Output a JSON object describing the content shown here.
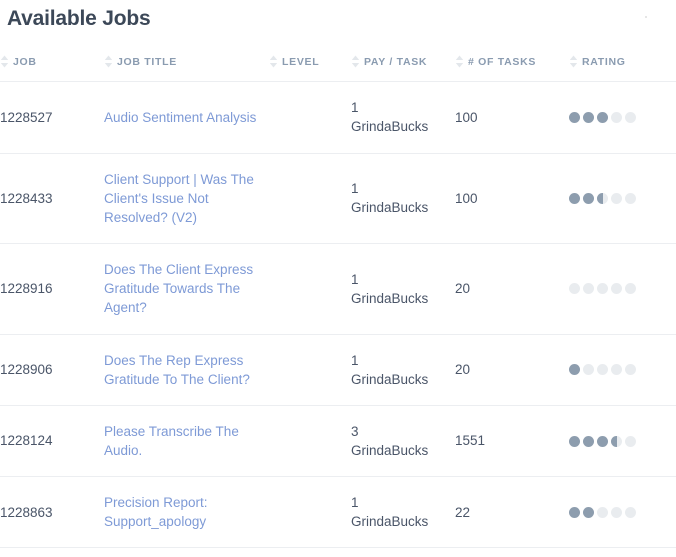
{
  "page": {
    "title": "Available Jobs"
  },
  "table": {
    "sort_icon": "sort-updown-icon",
    "columns": [
      {
        "key": "job",
        "label": "JOB"
      },
      {
        "key": "title",
        "label": "JOB TITLE"
      },
      {
        "key": "level",
        "label": "LEVEL"
      },
      {
        "key": "pay",
        "label": "PAY / TASK"
      },
      {
        "key": "tasks",
        "label": "# OF TASKS"
      },
      {
        "key": "rating",
        "label": "RATING"
      }
    ],
    "rows": [
      {
        "job": "1228527",
        "title": "Audio Sentiment Analysis",
        "level": "",
        "pay_amount": "1",
        "pay_currency": "GrindaBucks",
        "tasks": "100",
        "rating": 3,
        "rating_max": 5
      },
      {
        "job": "1228433",
        "title": "Client Support | Was The Client's Issue Not Resolved? (V2)",
        "level": "",
        "pay_amount": "1",
        "pay_currency": "GrindaBucks",
        "tasks": "100",
        "rating": 2.5,
        "rating_max": 5
      },
      {
        "job": "1228916",
        "title": "Does The Client Express Gratitude Towards The Agent?",
        "level": "",
        "pay_amount": "1",
        "pay_currency": "GrindaBucks",
        "tasks": "20",
        "rating": 0,
        "rating_max": 5
      },
      {
        "job": "1228906",
        "title": "Does The Rep Express Gratitude To The Client?",
        "level": "",
        "pay_amount": "1",
        "pay_currency": "GrindaBucks",
        "tasks": "20",
        "rating": 1,
        "rating_max": 5
      },
      {
        "job": "1228124",
        "title": "Please Transcribe The Audio.",
        "level": "",
        "pay_amount": "3",
        "pay_currency": "GrindaBucks",
        "tasks": "1551",
        "rating": 3.5,
        "rating_max": 5
      },
      {
        "job": "1228863",
        "title": "Precision Report: Support_apology",
        "level": "",
        "pay_amount": "1",
        "pay_currency": "GrindaBucks",
        "tasks": "22",
        "rating": 2,
        "rating_max": 5
      }
    ]
  },
  "colors": {
    "title": "#3c4858",
    "header_text": "#8a9bb0",
    "link": "#7e9ad6",
    "body_text": "#4a5568",
    "divider": "#eceef1",
    "dot_filled": "#8d9dae",
    "dot_empty": "#e9ecef"
  }
}
